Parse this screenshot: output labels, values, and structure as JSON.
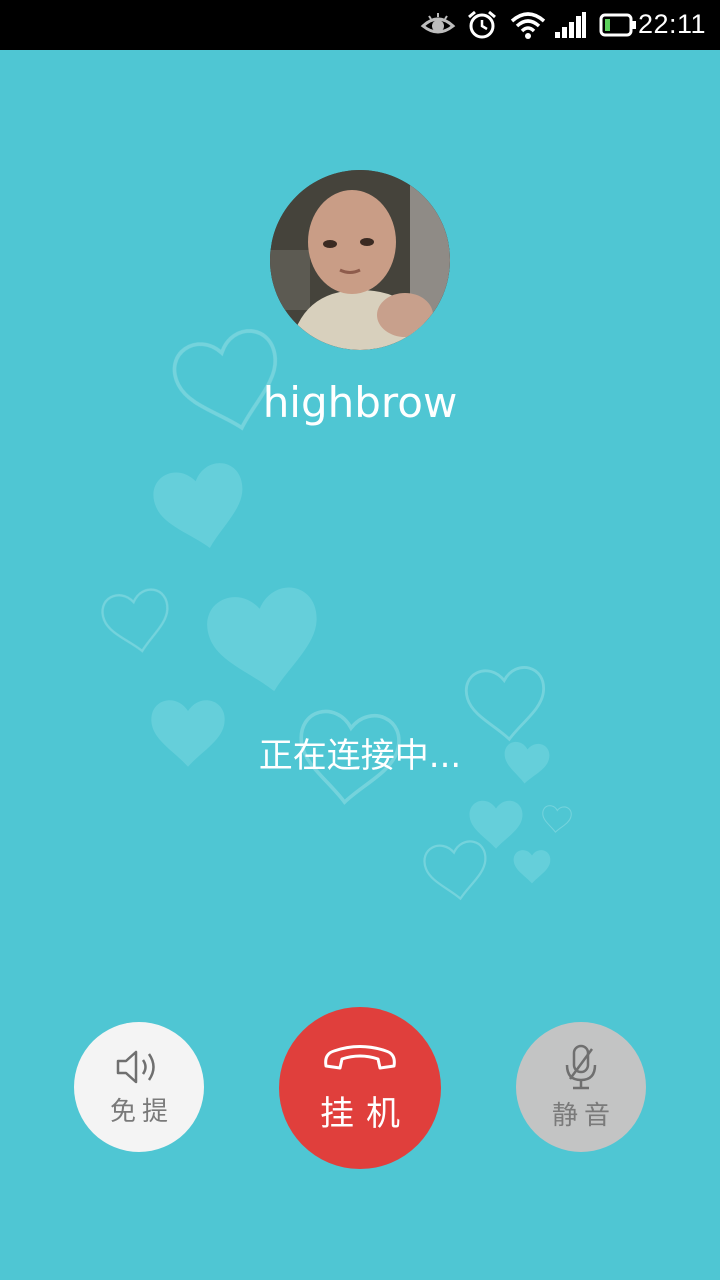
{
  "status_bar": {
    "time": "22:11",
    "icons": [
      "eye-icon",
      "alarm-icon",
      "wifi-icon",
      "signal-icon",
      "battery-icon"
    ]
  },
  "contact": {
    "name": "highbrow",
    "avatar_icon": "contact-avatar-photo"
  },
  "call": {
    "status": "正在连接中..."
  },
  "controls": {
    "speaker_label": "免提",
    "hangup_label": "挂机",
    "mute_label": "静音"
  },
  "colors": {
    "background": "#4fc6d3",
    "hangup": "#e03f3c",
    "speaker_bg": "#f4f4f4",
    "mute_bg": "#c3c4c4",
    "status_bar": "#000000"
  }
}
